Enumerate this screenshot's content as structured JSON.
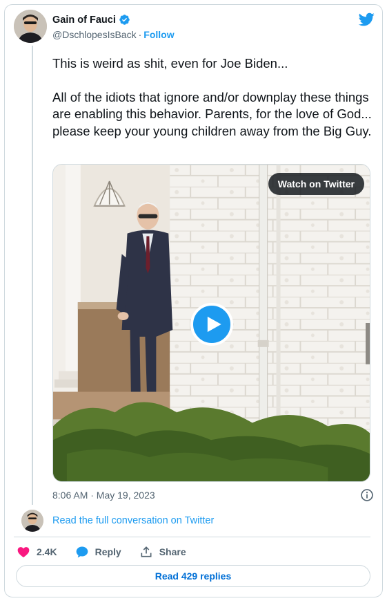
{
  "author": {
    "display_name": "Gain of Fauci",
    "handle": "@DschlopesIsBack",
    "separator": "·",
    "follow_label": "Follow"
  },
  "tweet": {
    "paragraphs": [
      "This is weird as shit, even for Joe Biden...",
      "All of the idiots that ignore and/or downplay these things are enabling this behavior.  Parents, for the love of God... please keep your young children away from the Big Guy."
    ],
    "timestamp": "8:06 AM · May 19, 2023"
  },
  "media": {
    "watch_label": "Watch on Twitter"
  },
  "conversation_link": "Read the full conversation on Twitter",
  "actions": {
    "likes": "2.4K",
    "reply_label": "Reply",
    "share_label": "Share"
  },
  "read_replies_label": "Read 429 replies",
  "colors": {
    "accent": "#1d9bf0",
    "like": "#f91880",
    "muted": "#536471",
    "border": "#cfd9de"
  },
  "icons": [
    "verified-badge-icon",
    "twitter-bird-icon",
    "play-icon",
    "info-icon",
    "heart-icon",
    "reply-bubble-icon",
    "share-icon"
  ]
}
